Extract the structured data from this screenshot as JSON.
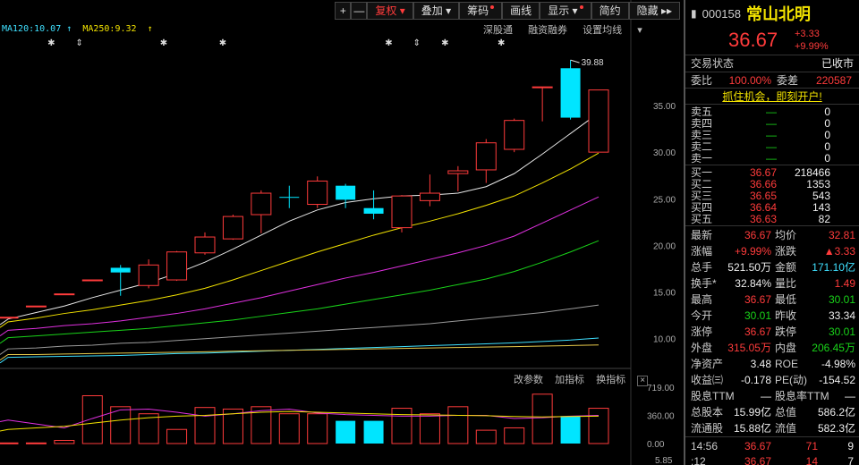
{
  "toolbar": {
    "plus": "+",
    "minus": "—",
    "restore": "复权",
    "overlay": "叠加",
    "chips": "筹码",
    "draw": "画线",
    "display": "显示",
    "simple": "简约",
    "hide": "隐藏",
    "more": "▸▸"
  },
  "ma": {
    "ma120": "MA120:10.07",
    "ma250": "MA250:9.32",
    "arrow": "↑"
  },
  "subnav": {
    "shenhai": "深股通",
    "margin": "融资融券",
    "setma": "设置均线"
  },
  "panel": {
    "params": "改参数",
    "add": "加指标",
    "swap": "换指标",
    "close": "×"
  },
  "annotation": "39.88",
  "stock": {
    "code": "000158",
    "name": "常山北明",
    "price": "36.67",
    "chg": "+3.33",
    "pct": "+9.99%"
  },
  "status": {
    "label": "交易状态",
    "value": "已收市"
  },
  "weibi": {
    "k1": "委比",
    "v1": "100.00%",
    "k2": "委差",
    "v2": "220587"
  },
  "ad": "抓住机会，即刻开户!",
  "sell": [
    {
      "label": "卖五",
      "price": "—",
      "vol": "0"
    },
    {
      "label": "卖四",
      "price": "—",
      "vol": "0"
    },
    {
      "label": "卖三",
      "price": "—",
      "vol": "0"
    },
    {
      "label": "卖二",
      "price": "—",
      "vol": "0"
    },
    {
      "label": "卖一",
      "price": "—",
      "vol": "0"
    }
  ],
  "buy": [
    {
      "label": "买一",
      "price": "36.67",
      "vol": "218466"
    },
    {
      "label": "买二",
      "price": "36.66",
      "vol": "1353"
    },
    {
      "label": "买三",
      "price": "36.65",
      "vol": "543"
    },
    {
      "label": "买四",
      "price": "36.64",
      "vol": "143"
    },
    {
      "label": "买五",
      "price": "36.63",
      "vol": "82"
    }
  ],
  "stats": [
    {
      "k1": "最新",
      "v1": "36.67",
      "c1": "red",
      "k2": "均价",
      "v2": "32.81",
      "c2": "red"
    },
    {
      "k1": "涨幅",
      "v1": "+9.99%",
      "c1": "red",
      "k2": "涨跌",
      "v2": "▲3.33",
      "c2": "red"
    },
    {
      "k1": "总手",
      "v1": "521.50万",
      "c1": "wh",
      "k2": "金额",
      "v2": "171.10亿",
      "c2": "cy"
    },
    {
      "k1": "换手*",
      "v1": "32.84%",
      "c1": "wh",
      "k2": "量比",
      "v2": "1.49",
      "c2": "red"
    },
    {
      "k1": "最高",
      "v1": "36.67",
      "c1": "red",
      "k2": "最低",
      "v2": "30.01",
      "c2": "grn"
    },
    {
      "k1": "今开",
      "v1": "30.01",
      "c1": "grn",
      "k2": "昨收",
      "v2": "33.34",
      "c2": "wh"
    },
    {
      "k1": "涨停",
      "v1": "36.67",
      "c1": "red",
      "k2": "跌停",
      "v2": "30.01",
      "c2": "grn"
    },
    {
      "k1": "外盘",
      "v1": "315.05万",
      "c1": "red",
      "k2": "内盘",
      "v2": "206.45万",
      "c2": "grn"
    },
    {
      "k1": "净资产",
      "v1": "3.48",
      "c1": "wh",
      "k2": "ROE",
      "v2": "-4.98%",
      "c2": "wh"
    },
    {
      "k1": "收益㈢",
      "v1": "-0.178",
      "c1": "wh",
      "k2": "PE(动)",
      "v2": "-154.52",
      "c2": "wh"
    },
    {
      "k1": "股息TTM",
      "v1": "—",
      "c1": "wh",
      "k2": "股息率TTM",
      "v2": "—",
      "c2": "wh"
    },
    {
      "k1": "总股本",
      "v1": "15.99亿",
      "c1": "wh",
      "k2": "总值",
      "v2": "586.2亿",
      "c2": "wh"
    },
    {
      "k1": "流通股",
      "v1": "15.88亿",
      "c1": "wh",
      "k2": "流值",
      "v2": "582.3亿",
      "c2": "wh"
    }
  ],
  "ticks": [
    {
      "time": "14:56",
      "price": "36.67",
      "vol": "71",
      "num": "9"
    },
    {
      "time": ":12",
      "price": "36.67",
      "vol": "14",
      "num": "7"
    }
  ],
  "chart_data": {
    "type": "candlestick",
    "ylim": [
      7,
      42
    ],
    "yticks": [
      "35.00",
      "30.00",
      "25.00",
      "20.00",
      "15.00",
      "10.00"
    ],
    "volticks": [
      "719.00",
      "360.00",
      "0.00"
    ],
    "bottom_tick": "5.85",
    "candles": [
      {
        "o": 12.3,
        "c": 12.3,
        "h": 12.3,
        "l": 12.3,
        "up": true
      },
      {
        "o": 13.5,
        "c": 13.5,
        "h": 13.5,
        "l": 13.5,
        "up": true
      },
      {
        "o": 14.8,
        "c": 14.8,
        "h": 14.8,
        "l": 14.8,
        "up": true
      },
      {
        "o": 16.3,
        "c": 16.3,
        "h": 16.3,
        "l": 16.3,
        "up": true
      },
      {
        "o": 17.6,
        "c": 17.1,
        "h": 17.9,
        "l": 14.6,
        "up": false
      },
      {
        "o": 15.7,
        "c": 17.9,
        "h": 18.5,
        "l": 15.4,
        "up": true
      },
      {
        "o": 16.3,
        "c": 19.3,
        "h": 19.4,
        "l": 16.2,
        "up": true
      },
      {
        "o": 19.2,
        "c": 20.9,
        "h": 21.4,
        "l": 19.0,
        "up": true
      },
      {
        "o": 20.7,
        "c": 23.1,
        "h": 23.3,
        "l": 20.6,
        "up": true
      },
      {
        "o": 23.3,
        "c": 25.6,
        "h": 25.9,
        "l": 21.3,
        "up": true
      },
      {
        "o": 25.2,
        "c": 25.2,
        "h": 26.4,
        "l": 24.0,
        "up": false
      },
      {
        "o": 24.4,
        "c": 26.9,
        "h": 27.4,
        "l": 24.0,
        "up": true
      },
      {
        "o": 26.4,
        "c": 24.9,
        "h": 26.6,
        "l": 24.0,
        "up": false
      },
      {
        "o": 24.0,
        "c": 23.4,
        "h": 25.9,
        "l": 22.8,
        "up": false
      },
      {
        "o": 21.9,
        "c": 25.3,
        "h": 25.4,
        "l": 21.4,
        "up": true
      },
      {
        "o": 24.8,
        "c": 25.6,
        "h": 27.6,
        "l": 24.2,
        "up": true
      },
      {
        "o": 27.7,
        "c": 28.0,
        "h": 28.5,
        "l": 25.8,
        "up": true
      },
      {
        "o": 28.1,
        "c": 31.0,
        "h": 31.4,
        "l": 26.7,
        "up": true
      },
      {
        "o": 30.3,
        "c": 33.4,
        "h": 33.6,
        "l": 30.0,
        "up": true
      },
      {
        "o": 37.0,
        "c": 37.0,
        "h": 37.0,
        "l": 33.3,
        "up": true
      },
      {
        "o": 39.0,
        "c": 33.7,
        "h": 39.88,
        "l": 33.5,
        "up": false
      },
      {
        "o": 30.0,
        "c": 36.67,
        "h": 36.67,
        "l": 30.01,
        "up": true
      }
    ],
    "ma_white": [
      12.1,
      12.8,
      13.5,
      14.4,
      15.2,
      16.0,
      17.0,
      18.2,
      19.6,
      21.1,
      22.6,
      23.8,
      24.6,
      25.0,
      25.3,
      25.4,
      25.6,
      26.3,
      27.7,
      29.8,
      32.0,
      34.2
    ],
    "ma_yellow": [
      11.8,
      12.2,
      12.7,
      13.1,
      13.6,
      14.1,
      14.7,
      15.4,
      16.3,
      17.3,
      18.3,
      19.3,
      20.2,
      21.1,
      21.9,
      22.6,
      23.4,
      24.3,
      25.3,
      26.7,
      28.2,
      29.9
    ],
    "ma_magenta": [
      10.9,
      11.1,
      11.4,
      11.6,
      11.9,
      12.3,
      12.7,
      13.2,
      13.8,
      14.4,
      15.1,
      15.8,
      16.5,
      17.1,
      17.8,
      18.5,
      19.2,
      20.0,
      21.0,
      22.4,
      23.8,
      25.2
    ],
    "ma_green": [
      10.1,
      10.3,
      10.5,
      10.7,
      10.9,
      11.1,
      11.4,
      11.7,
      12.0,
      12.4,
      12.8,
      13.2,
      13.7,
      14.2,
      14.7,
      15.2,
      15.8,
      16.4,
      17.2,
      18.2,
      19.3,
      20.5
    ],
    "ma_gray": [
      8.9,
      9.0,
      9.2,
      9.3,
      9.5,
      9.6,
      9.8,
      10.0,
      10.2,
      10.4,
      10.6,
      10.8,
      11.0,
      11.2,
      11.4,
      11.6,
      11.9,
      12.2,
      12.5,
      12.8,
      13.2,
      13.6
    ],
    "ma_cyan": [
      8.0,
      8.05,
      8.1,
      8.15,
      8.2,
      8.3,
      8.4,
      8.45,
      8.55,
      8.65,
      8.75,
      8.85,
      8.95,
      9.05,
      9.15,
      9.25,
      9.35,
      9.45,
      9.55,
      9.7,
      9.85,
      10.07
    ],
    "ma_olive": [
      8.3,
      8.3,
      8.35,
      8.4,
      8.45,
      8.5,
      8.55,
      8.6,
      8.65,
      8.7,
      8.75,
      8.8,
      8.85,
      8.9,
      8.95,
      9.0,
      9.05,
      9.1,
      9.15,
      9.2,
      9.26,
      9.32
    ],
    "volumes": [
      {
        "v": 8,
        "up": true
      },
      {
        "v": 8,
        "up": true
      },
      {
        "v": 40,
        "up": true
      },
      {
        "v": 610,
        "up": true
      },
      {
        "v": 470,
        "up": true
      },
      {
        "v": 380,
        "up": true
      },
      {
        "v": 180,
        "up": true
      },
      {
        "v": 460,
        "up": true
      },
      {
        "v": 440,
        "up": true
      },
      {
        "v": 470,
        "up": true
      },
      {
        "v": 380,
        "up": true
      },
      {
        "v": 380,
        "up": true
      },
      {
        "v": 290,
        "up": false
      },
      {
        "v": 290,
        "up": false
      },
      {
        "v": 450,
        "up": true
      },
      {
        "v": 380,
        "up": true
      },
      {
        "v": 470,
        "up": true
      },
      {
        "v": 170,
        "up": true
      },
      {
        "v": 200,
        "up": true
      },
      {
        "v": 630,
        "up": true
      },
      {
        "v": 350,
        "up": false
      },
      {
        "v": 450,
        "up": true
      }
    ],
    "vol_ma1": [
      300,
      250,
      200,
      320,
      430,
      440,
      400,
      350,
      380,
      420,
      440,
      390,
      370,
      360,
      350,
      350,
      360,
      360,
      320,
      330,
      350,
      360
    ],
    "vol_ma2": [
      180,
      200,
      220,
      260,
      300,
      330,
      350,
      360,
      380,
      400,
      410,
      400,
      390,
      380,
      370,
      365,
      360,
      355,
      345,
      340,
      345,
      350
    ],
    "markers": [
      {
        "i": 1.6,
        "s": "✱"
      },
      {
        "i": 2.6,
        "s": "⇕"
      },
      {
        "i": 5.6,
        "s": "✱"
      },
      {
        "i": 7.7,
        "s": "✱"
      },
      {
        "i": 13.6,
        "s": "✱"
      },
      {
        "i": 14.6,
        "s": "⇕"
      },
      {
        "i": 15.6,
        "s": "✱"
      },
      {
        "i": 17.6,
        "s": "✱"
      }
    ]
  }
}
